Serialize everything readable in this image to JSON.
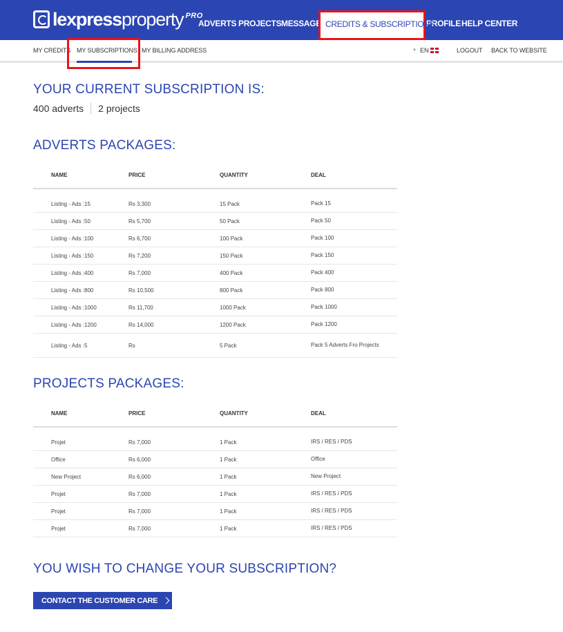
{
  "brand": {
    "logo_bold": "lexpress",
    "logo_light": "property",
    "logo_badge": "PRO"
  },
  "main_nav": {
    "adverts": "ADVERTS",
    "projects": "PROJECTS",
    "messages": "MESSAGES",
    "credits": "CREDITS & SUBSCRIPTIONS",
    "profile": "PROFILE",
    "help": "HELP CENTER"
  },
  "sub_nav": {
    "my_credits": "MY CREDITS",
    "my_subscriptions": "MY SUBSCRIPTIONS",
    "billing": "MY BILLING ADDRESS",
    "language": "EN",
    "logout": "LOGOUT",
    "back": "BACK TO WEBSITE"
  },
  "current_subscription": {
    "heading": "YOUR CURRENT SUBSCRIPTION IS:",
    "adverts": "400 adverts",
    "projects": "2 projects"
  },
  "adverts_packages": {
    "heading": "ADVERTS PACKAGES:",
    "columns": [
      "NAME",
      "PRICE",
      "QUANTITY",
      "DEAL"
    ],
    "rows": [
      [
        "Listing - Ads :15",
        "Rs 3,300",
        "15 Pack",
        "Pack 15"
      ],
      [
        "Listing - Ads :50",
        "Rs 5,700",
        "50 Pack",
        "Pack 50"
      ],
      [
        "Listing - Ads :100",
        "Rs 6,700",
        "100 Pack",
        "Pack 100"
      ],
      [
        "Listing - Ads :150",
        "Rs 7,200",
        "150 Pack",
        "Pack 150"
      ],
      [
        "Listing - Ads :400",
        "Rs 7,000",
        "400 Pack",
        "Pack 400"
      ],
      [
        "Listing - Ads :800",
        "Rs 10,500",
        "800 Pack",
        "Pack 800"
      ],
      [
        "Listing - Ads :1000",
        "Rs 11,700",
        "1000 Pack",
        "Pack 1000"
      ],
      [
        "Listing - Ads :1200",
        "Rs 14,000",
        "1200 Pack",
        "Pack 1200"
      ],
      [
        "Listing - Ads :5",
        "Rs",
        "5 Pack",
        "Pack 5 Adverts Fro Projects"
      ]
    ]
  },
  "projects_packages": {
    "heading": "PROJECTS PACKAGES:",
    "columns": [
      "NAME",
      "PRICE",
      "QUANTITY",
      "DEAL"
    ],
    "rows": [
      [
        "Projet",
        "Rs 7,000",
        "1 Pack",
        "IRS / RES / PDS"
      ],
      [
        "Office",
        "Rs 6,000",
        "1 Pack",
        "Office"
      ],
      [
        "New Project",
        "Rs 6,000",
        "1 Pack",
        "New Project"
      ],
      [
        "Projet",
        "Rs 7,000",
        "1 Pack",
        "IRS / RES / PDS"
      ],
      [
        "Projet",
        "Rs 7,000",
        "1 Pack",
        "IRS / RES / PDS"
      ],
      [
        "Projet",
        "Rs 7,000",
        "1 Pack",
        "IRS / RES / PDS"
      ]
    ]
  },
  "change": {
    "heading": "YOU WISH TO CHANGE YOUR SUBSCRIPTION?",
    "button": "CONTACT THE CUSTOMER CARE"
  },
  "colors": {
    "brand_blue": "#2b45b2",
    "highlight_red": "#e8131a"
  }
}
